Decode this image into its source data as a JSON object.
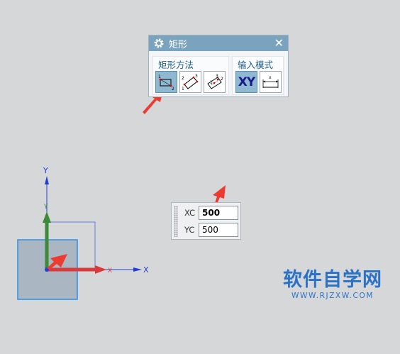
{
  "dialog": {
    "title": "矩形",
    "close_glyph": "✕",
    "method_group": {
      "label": "矩形方法",
      "tools": [
        {
          "icon": "rect-two-point-icon",
          "active": true
        },
        {
          "icon": "rect-three-point-icon",
          "active": false
        },
        {
          "icon": "rect-from-center-icon",
          "active": false
        }
      ]
    },
    "mode_group": {
      "label": "输入模式",
      "tools": [
        {
          "icon": "coordinate-mode-icon",
          "text": "XY",
          "active": true
        },
        {
          "icon": "parameter-mode-icon",
          "active": false
        }
      ]
    }
  },
  "coord_input": {
    "xc_label": "XC",
    "xc_value": "500",
    "yc_label": "YC",
    "yc_value": "500"
  },
  "axes": {
    "y_label": "Y",
    "x_label": "X",
    "x_label_inner": "X",
    "y_label_inner": "Y"
  },
  "colors": {
    "title_bar": "#7aa3bd",
    "x_axis": "#d93b3b",
    "y_axis": "#3e8a3a",
    "ref_axis": "#1f3fd6",
    "rect_fill": "#aab6c2",
    "rect_stroke": "#2d8fe6",
    "arrow": "#ee3b30"
  },
  "watermark": {
    "title": "软件自学网",
    "url": "WWW.RJZXW.COM"
  }
}
